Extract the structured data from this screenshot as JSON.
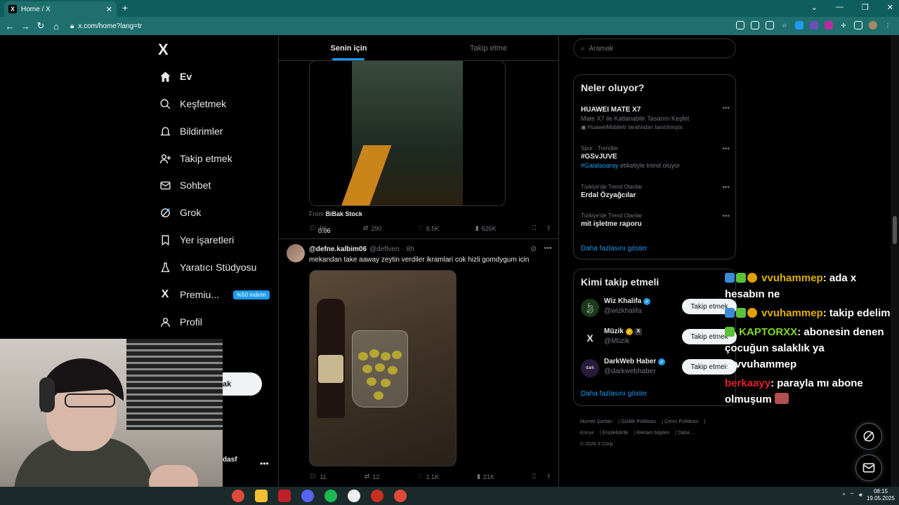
{
  "browser": {
    "tab_title": "Home / X",
    "url": "x.com/home?lang=tr",
    "new_tab": "+",
    "tab_close": "✕"
  },
  "nav": {
    "logo": "X",
    "items": [
      {
        "label": "Ev",
        "icon": "home-icon"
      },
      {
        "label": "Keşfetmek",
        "icon": "search-icon"
      },
      {
        "label": "Bildirimler",
        "icon": "bell-icon"
      },
      {
        "label": "Takip etmek",
        "icon": "person-add-icon"
      },
      {
        "label": "Sohbet",
        "icon": "mail-icon"
      },
      {
        "label": "Grok",
        "icon": "grok-icon"
      },
      {
        "label": "Yer işaretleri",
        "icon": "bookmark-icon"
      },
      {
        "label": "Yaratıcı Stüdyosu",
        "icon": "flask-icon"
      },
      {
        "label": "Premiu...",
        "icon": "x-icon"
      },
      {
        "label": "Profil",
        "icon": "profile-icon"
      }
    ],
    "premium_badge": "%50 indirim",
    "post_button_peek": "ak",
    "account_peek": "dasf",
    "account_more": "•••"
  },
  "timeline": {
    "tabs": [
      "Senin için",
      "Takip etme"
    ],
    "tweet1": {
      "video_time": "0:06",
      "from_prefix": "From",
      "from_source": "BiBak Stock",
      "replies": "96",
      "reposts": "290",
      "likes": "6.5K",
      "views": "626K"
    },
    "tweet2": {
      "name": "@defne.kalbim06",
      "handle": "@deflven",
      "time": "· 8h",
      "text": "mekandan take aaway zeytin verdiler ikramlari cok hizli gomdygum icin",
      "more": "•••",
      "replies": "11",
      "reposts": "12",
      "likes": "1.1K",
      "views": "21K"
    }
  },
  "right": {
    "search_placeholder": "Aramak",
    "trends_title": "Neler oluyor?",
    "trends": [
      {
        "category": "",
        "title": "HUAWEI MATE X7",
        "sub": "Mate X7 ile Katlanabilir Tasarım Keşfet",
        "sub2": "HuaweiMobiletr tarafından tanıtılmıştır."
      },
      {
        "category": "Spor · Trendler",
        "title": "#GSvJUVE",
        "sub_link": "#Galatasaray",
        "sub_rest": " etiketiyle trend oluyor"
      },
      {
        "category": "Türkiye'de Trend Olanlar",
        "title": "Erdal Özyağcılar"
      },
      {
        "category": "Türkiye'de Trend Olanlar",
        "title": "mit işletme raporu"
      }
    ],
    "trend_more": "•••",
    "trends_showmore": "Daha fazlasını göster",
    "who_title": "Kimi takip etmeli",
    "accounts": [
      {
        "name": "Wiz Khalifa",
        "handle": "@wizkhalifa",
        "follow": "Takip etmek"
      },
      {
        "name": "Müzik",
        "handle": "@Müzik",
        "follow": "Takip etmek"
      },
      {
        "name": "DarkWeb Haber",
        "handle": "@darkwebhaber",
        "follow": "Takip etmek"
      }
    ],
    "who_showmore": "Daha fazlasını göster",
    "footer": [
      "Hizmet Şartları",
      "Gizlilik Politikası",
      "Çerez Politikası",
      "Künye",
      "Erişilebilirlik",
      "Reklam bilgileri",
      "Daha ...",
      "© 2026 X Corp."
    ]
  },
  "chat": [
    {
      "user": "vvuhammep",
      "text": ": ada x hesabın ne"
    },
    {
      "user": "vvuhammep",
      "text": ": takip edelim"
    },
    {
      "user": "KAPTORXX",
      "text": ": abonesin denen çocuğun salaklık ya @vvuhammep"
    },
    {
      "user": "berkaayy",
      "text": ": parayla mı abone olmuşum"
    }
  ],
  "taskbar": {
    "time": "08:15",
    "date": "19.05.2025"
  },
  "colors": {
    "accent": "#1d9bf0",
    "chrome": "#1f6f6f",
    "border": "#2f3336"
  }
}
